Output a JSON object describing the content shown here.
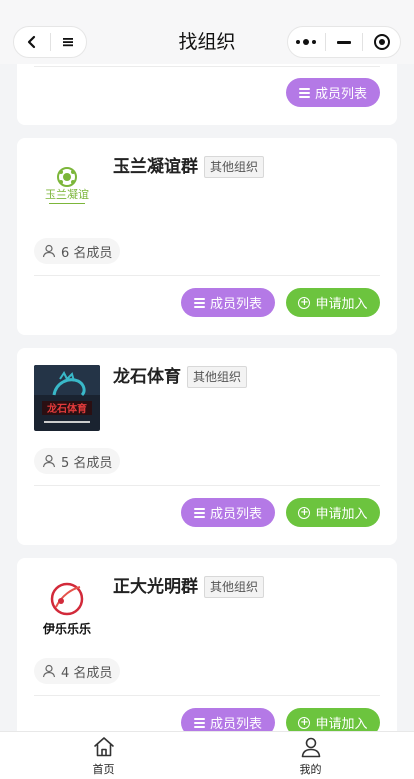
{
  "header": {
    "title": "找组织",
    "back_icon": "chevron-left-icon",
    "menu_icon": "hamburger-icon",
    "more_icon": "more-dots-icon",
    "minimize_icon": "minimize-icon",
    "close_icon": "target-close-icon"
  },
  "partial_card": {
    "members_btn_label": "成员列表"
  },
  "orgs": [
    {
      "name": "玉兰凝谊群",
      "tag": "其他组织",
      "member_count_text": "6 名成员",
      "members_btn_label": "成员列表",
      "join_btn_label": "申请加入",
      "logo_text": "玉兰凝谊",
      "logo_color": "#7cb63a"
    },
    {
      "name": "龙石体育",
      "tag": "其他组织",
      "member_count_text": "5 名成员",
      "members_btn_label": "成员列表",
      "join_btn_label": "申请加入",
      "logo_text": "龙石体育",
      "logo_color": "#d93a3a"
    },
    {
      "name": "正大光明群",
      "tag": "其他组织",
      "member_count_text": "4 名成员",
      "members_btn_label": "成员列表",
      "join_btn_label": "申请加入",
      "logo_text": "伊乐乐乐",
      "logo_color": "#d22a3a"
    }
  ],
  "tabbar": {
    "items": [
      {
        "label": "首页",
        "icon": "home-icon"
      },
      {
        "label": "我的",
        "icon": "person-icon"
      }
    ]
  },
  "colors": {
    "purple_button": "#b479e6",
    "green_button": "#6cc43e",
    "background": "#f3f4f6"
  }
}
